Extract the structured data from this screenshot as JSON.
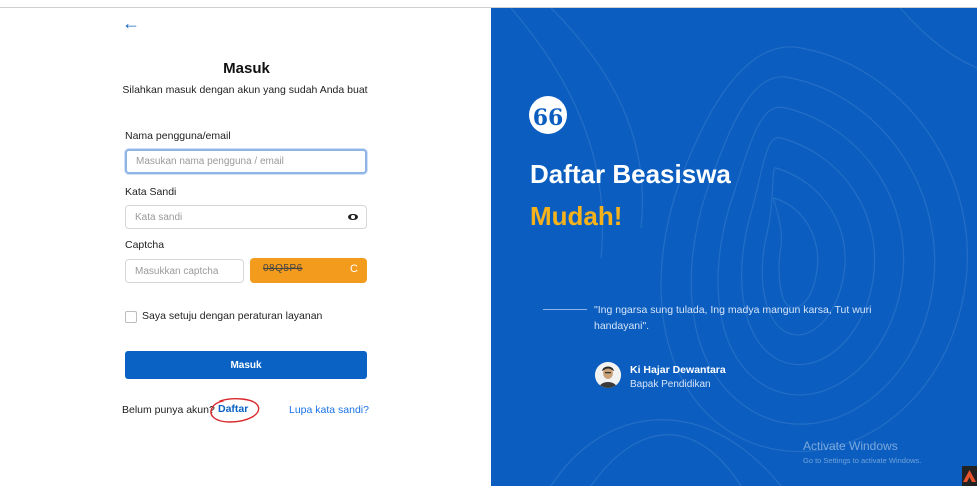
{
  "colors": {
    "primary": "#0a63c4",
    "panel_bg": "#0b5ec0",
    "accent_orange": "#f29b1c",
    "headline_accent": "#f6b21b",
    "annotation_red": "#d9262b"
  },
  "icons": {
    "back": "arrow-left-icon",
    "password_toggle": "eye-icon",
    "captcha_refresh": "refresh-icon",
    "quote": "quote-icon"
  },
  "login": {
    "back_arrow": "←",
    "title": "Masuk",
    "subtitle": "Silahkan masuk dengan akun yang sudah Anda buat",
    "username": {
      "label": "Nama pengguna/email",
      "placeholder": "Masukan nama pengguna / email",
      "value": ""
    },
    "password": {
      "label": "Kata Sandi",
      "placeholder": "Kata sandi",
      "value": ""
    },
    "captcha": {
      "label": "Captcha",
      "placeholder": "Masukkan captcha",
      "value": "",
      "code": "08Q5P6",
      "refresh_glyph": "C"
    },
    "terms_label": "Saya setuju dengan peraturan layanan",
    "terms_checked": false,
    "submit_label": "Masuk",
    "no_account_text": "Belum punya akun?",
    "register_link": "Daftar",
    "forgot_link": "Lupa kata sandi?"
  },
  "promo": {
    "quote_mark": "66",
    "headline": "Daftar Beasiswa",
    "headline_accent": "Mudah!",
    "quote": "\"Ing ngarsa sung tulada, Ing madya mangun karsa, Tut wuri handayani\".",
    "person_name": "Ki Hajar Dewantara",
    "person_role": "Bapak Pendidikan"
  },
  "watermark": {
    "title": "Activate Windows",
    "subtitle": "Go to Settings to activate Windows."
  }
}
